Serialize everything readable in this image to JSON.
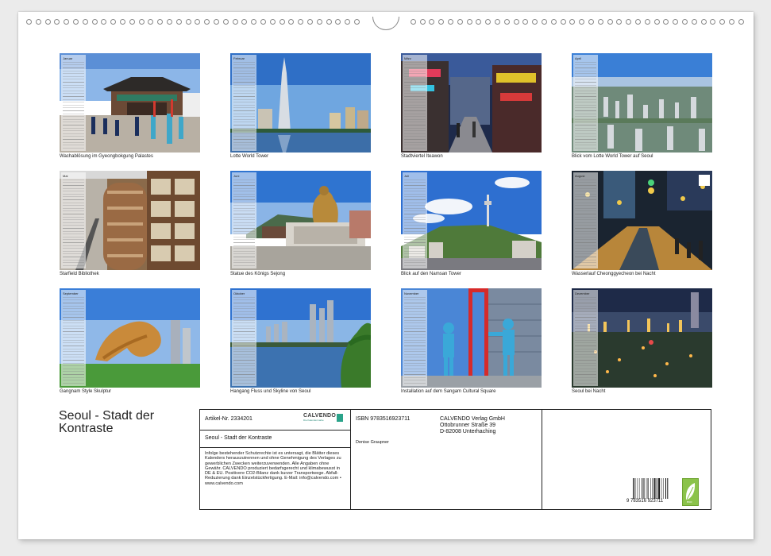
{
  "months": [
    {
      "name": "Januar",
      "caption": "Wachablösung im Gyeongbokgung Palastes"
    },
    {
      "name": "Februar",
      "caption": "Lotte World Tower"
    },
    {
      "name": "März",
      "caption": "Stadtviertel Iteawon"
    },
    {
      "name": "April",
      "caption": "Blick vom Lotte World Tower auf Seoul"
    },
    {
      "name": "Mai",
      "caption": "Starfield Bibliothek"
    },
    {
      "name": "Juni",
      "caption": "Statue des Königs Sejong"
    },
    {
      "name": "Juli",
      "caption": "Blick auf den Namsan Tower"
    },
    {
      "name": "August",
      "caption": "Wasserlauf Cheonggyecheon bei Nacht"
    },
    {
      "name": "September",
      "caption": "Gangnam Style Skulptur"
    },
    {
      "name": "Oktober",
      "caption": "Hangang Fluss und Skyline von Seoul"
    },
    {
      "name": "November",
      "caption": "Installation auf dem Sangam Cultural Square"
    },
    {
      "name": "Dezember",
      "caption": "Seoul bei Nacht"
    }
  ],
  "title": "Seoul - Stadt der Kontraste",
  "info": {
    "article": "Artikel-Nr. 2334201",
    "logo": "CALVENDO",
    "logo_sub": "Die Kalendermarke",
    "subtitle": "Seoul - Stadt der Kontraste",
    "legal": "Infolge bestehender Schutzrechte ist es untersagt, die Blätter dieses Kalenders herauszutrennen und ohne Genehmigung des Verlages zu gewerblichen Zwecken weiterzuverwenden. Alle Angaben ohne Gewähr. CALVENDO produziert bedarfsgerecht und klimabewusst in DE & EU. Positivere CO2-Bilanz dank kurzer Transportwege. Abfall-Reduzierung dank Einzelstückfertigung. E-Mail: info@calvendo.com • www.calvendo.com",
    "isbn": "ISBN 9783516923711",
    "publisher": [
      "CALVENDO Verlag GmbH",
      "Ottobrunner Straße 39",
      "D-82008 Unterhaching"
    ],
    "author": "Denise Graupner",
    "barcode_number": "9 783516 923711",
    "eco_label": "eco"
  }
}
